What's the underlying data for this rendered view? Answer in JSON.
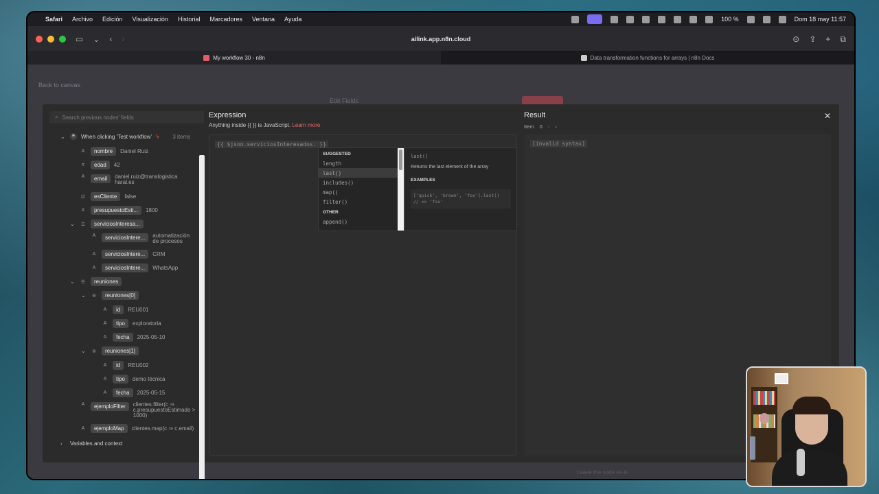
{
  "menubar": {
    "items": [
      "Safari",
      "Archivo",
      "Edición",
      "Visualización",
      "Historial",
      "Marcadores",
      "Ventana",
      "Ayuda"
    ],
    "battery": "100 %",
    "datetime": "Dom 18 may 11:57"
  },
  "browser": {
    "url": "ailink.app.n8n.cloud",
    "tabs": [
      {
        "label": "My workflow 30 - n8n"
      },
      {
        "label": "Data transformation functions for arrays | n8n Docs"
      }
    ]
  },
  "background_page": {
    "back_link": "Back to canvas",
    "node_title": "Edit Fields"
  },
  "left_panel": {
    "search_placeholder": "Search previous nodes' fields",
    "trigger": {
      "label": "When clicking ‘Test workflow’",
      "count": "3 items"
    },
    "fields": [
      {
        "type": "A",
        "name": "nombre",
        "value": "Daniel Ruiz"
      },
      {
        "type": "#",
        "name": "edad",
        "value": "42"
      },
      {
        "type": "A",
        "name": "email",
        "value": "daniel.ruiz@translogisticaharal.es"
      },
      {
        "type": "☑",
        "name": "esCliente",
        "value": "false"
      },
      {
        "type": "#",
        "name": "presupuestoEsti...",
        "value": "1800"
      },
      {
        "type": "☰",
        "name": "serviciosInteresa...",
        "value": ""
      },
      {
        "type": "A",
        "name": "serviciosIntere...",
        "value": "automatización de procesos"
      },
      {
        "type": "A",
        "name": "serviciosIntere...",
        "value": "CRM"
      },
      {
        "type": "A",
        "name": "serviciosIntere...",
        "value": "WhatsApp"
      },
      {
        "type": "☰",
        "name": "reuniones",
        "value": ""
      },
      {
        "type": "⊚",
        "name": "reuniones[0]",
        "value": ""
      },
      {
        "type": "A",
        "name": "id",
        "value": "REU001"
      },
      {
        "type": "A",
        "name": "tipo",
        "value": "exploratoria"
      },
      {
        "type": "A",
        "name": "fecha",
        "value": "2025-05-10"
      },
      {
        "type": "⊚",
        "name": "reuniones[1]",
        "value": ""
      },
      {
        "type": "A",
        "name": "id",
        "value": "REU002"
      },
      {
        "type": "A",
        "name": "tipo",
        "value": "demo técnica"
      },
      {
        "type": "A",
        "name": "fecha",
        "value": "2025-05-15"
      },
      {
        "type": "A",
        "name": "ejemploFilter",
        "value": "clientes.filter(c ⇒ c.presupuestoEstimado > 1000)"
      },
      {
        "type": "A",
        "name": "ejemploMap",
        "value": "clientes.map(c ⇒ c.email)"
      }
    ],
    "variables_label": "Variables and context"
  },
  "expression": {
    "title": "Expression",
    "subtitle": "Anything inside {{ }} is JavaScript.",
    "learn_more": "Learn more",
    "code": "{{ $json.serviciosInteresados. }}"
  },
  "autocomplete": {
    "suggested_label": "SUGGESTED",
    "suggested": [
      "length",
      "last()",
      "includes()",
      "map()",
      "filter()"
    ],
    "selected_index": 1,
    "other_label": "OTHER",
    "other": [
      "append()"
    ]
  },
  "doc": {
    "signature": "last()",
    "description": "Returns the last element of the array",
    "examples_label": "EXAMPLES",
    "example_line1": "['quick', 'brown', 'fox'].last()",
    "example_line2": "// => 'fox'"
  },
  "result": {
    "title": "Result",
    "item_label": "Item",
    "item_index": "0",
    "value": "[invalid syntax]"
  },
  "bottom_hint": "Leave the node as-is"
}
